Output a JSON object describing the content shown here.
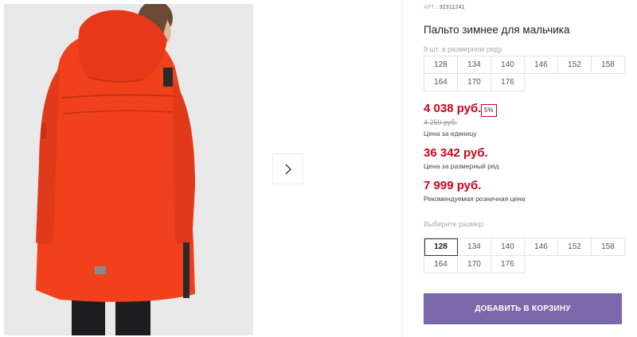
{
  "product": {
    "art_label": "АРТ.:",
    "art_value": "32311241",
    "title": "Пальто зимнее для мальчика",
    "row_note": "9 шт. в размерном ряду",
    "row_sizes": [
      "128",
      "134",
      "140",
      "146",
      "152",
      "158",
      "164",
      "170",
      "176"
    ]
  },
  "pricing": {
    "unit_price": "4 038 руб.",
    "discount": "5%",
    "old_price": "4 250 руб.",
    "unit_label": "Цена за единицу",
    "row_price": "36 342 руб.",
    "row_label": "Цена за размерный ряд",
    "rrp_price": "7 999 руб.",
    "rrp_label": "Рекомендуемая розничная цена"
  },
  "size_picker": {
    "label": "Выберите размер:",
    "sizes": [
      "128",
      "134",
      "140",
      "146",
      "152",
      "158",
      "164",
      "170",
      "176"
    ],
    "selected": "128"
  },
  "actions": {
    "add_to_cart": "ДОБАВИТЬ В КОРЗИНУ"
  },
  "gallery": {
    "icons": {
      "next": "chevron-right-icon"
    },
    "colors": {
      "coat": "#f1411c",
      "background": "#e9e9e9"
    }
  },
  "colors": {
    "price": "#d0021b",
    "button": "#7b68aa"
  }
}
